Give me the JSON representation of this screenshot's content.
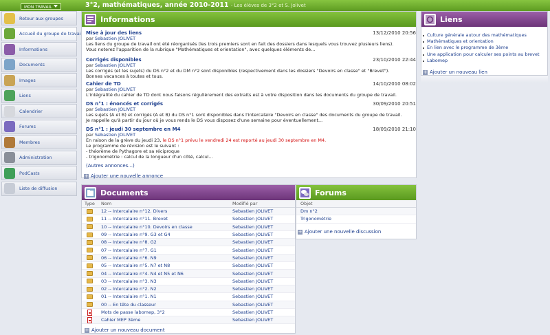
{
  "header": {
    "menu_label": "MON TRAVAIL",
    "title": "3°2, mathématiques, année 2010-2011",
    "subtitle": "- Les élèves de 3°2 et S. Jolivet"
  },
  "sidebar": {
    "items": [
      {
        "label": "Retour aux groupes",
        "icon": "back-arrow-icon",
        "color": "#e3c04a"
      },
      {
        "label": "Accueil du groupe de travail",
        "icon": "home-icon",
        "color": "#6ca83a"
      },
      {
        "label": "Informations",
        "icon": "info-icon",
        "color": "#8b5ca8"
      },
      {
        "label": "Documents",
        "icon": "documents-icon",
        "color": "#7da4c8"
      },
      {
        "label": "Images",
        "icon": "images-icon",
        "color": "#c9a455"
      },
      {
        "label": "Liens",
        "icon": "link-icon",
        "color": "#4ea35a"
      },
      {
        "label": "Calendrier",
        "icon": "calendar-icon",
        "color": "#d6d8dd"
      },
      {
        "label": "Forums",
        "icon": "forums-icon",
        "color": "#7b6bbf"
      },
      {
        "label": "Membres",
        "icon": "members-icon",
        "color": "#b07a3a"
      },
      {
        "label": "Administration",
        "icon": "administration-icon",
        "color": "#8a8f99"
      },
      {
        "label": "PodCasts",
        "icon": "podcast-icon",
        "color": "#3f9f58"
      },
      {
        "label": "Liste de diffusion",
        "icon": "mailing-list-icon",
        "color": "#c7ccd6"
      }
    ]
  },
  "informations": {
    "title": "Informations",
    "items": [
      {
        "title": "Mise à jour des liens",
        "author_prefix": "par",
        "author": "Sebastien JOLIVET",
        "date": "13/12/2010 20:56",
        "body": [
          "Les liens du groupe de travail ont été réorganisés (les trois premiers sont en fait des dossiers dans lesquels vous trouvez plusieurs liens).",
          "Vous noterez l'apparition de la rubrique \"Mathématiques et orientation\", avec quelques éléments de..."
        ]
      },
      {
        "title": "Corrigés disponibles",
        "author_prefix": "par",
        "author": "Sebastien JOLIVET",
        "date": "23/10/2010 22:44",
        "body": [
          "Les corrigés (et les sujets) du DS n°2 et du DM n°2 sont disponibles (respectivement dans les dossiers \"Devoirs en classe\" et \"Brevet\").",
          "Bonnes vacances à toutes et tous."
        ]
      },
      {
        "title": "Cahier de TD",
        "author_prefix": "par",
        "author": "Sebastien JOLIVET",
        "date": "14/10/2010 08:02",
        "body": [
          "L'intégralité du cahier de TD dont nous faisons régulièrement des extraits est à votre disposition dans les documents du groupe de travail."
        ]
      },
      {
        "title": "DS n°1 : énoncés et corrigés",
        "author_prefix": "par",
        "author": "Sebastien JOLIVET",
        "date": "30/09/2010 20:51",
        "body": [
          "Les sujets (A et B) et corrigés (A et B) du DS n°1 sont disponibles dans l'intercalaire \"Devoirs en classe\" des documents du groupe de travail.",
          "Je rappelle qu'à partir du jour où je vous rends le DS vous disposez d'une semaine pour éventuellement..."
        ]
      },
      {
        "title": "DS n°1 : jeudi 30 septembre en M4",
        "author_prefix": "par",
        "author": "Sebastien JOLIVET",
        "date": "18/09/2010 21:10",
        "body_red_prefix": "En raison de la grève du jeudi 23,",
        "body_red": "le DS n°1 prévu le vendredi 24 est reporté au jeudi 30 septembre en M4.",
        "body": [
          "Le programme de révision est le suivant :",
          "- théorème de Pythagore et sa réciproque",
          "- trigonométrie : calcul de la longueur d'un côté, calcul..."
        ]
      }
    ],
    "more_link": "(Autres annonces...)",
    "add_link": "Ajouter une nouvelle annonce"
  },
  "liens": {
    "title": "Liens",
    "items": [
      "Culture générale autour des mathématiques",
      "Mathématiques et orientation",
      "En lien avec le programme de 3ème",
      "Une application pour calculer ses points au brevet",
      "Labomep"
    ],
    "add_link": "Ajouter un nouveau lien"
  },
  "documents": {
    "title": "Documents",
    "columns": {
      "type": "Type",
      "name": "Nom",
      "modified": "Modifié par"
    },
    "rows": [
      {
        "type": "folder",
        "name": "12 -- Intercalaire n°12. Divers",
        "modified": "Sebastien JOLIVET"
      },
      {
        "type": "folder",
        "name": "11 -- Intercalaire n°11. Brevet",
        "modified": "Sebastien JOLIVET"
      },
      {
        "type": "folder",
        "name": "10 -- Intercalaire n°10. Devoirs en classe",
        "modified": "Sebastien JOLIVET"
      },
      {
        "type": "folder",
        "name": "09 -- Intercalaire n°9. G3 et G4",
        "modified": "Sebastien JOLIVET"
      },
      {
        "type": "folder",
        "name": "08 -- Intercalaire n°8. G2",
        "modified": "Sebastien JOLIVET"
      },
      {
        "type": "folder",
        "name": "07 -- Intercalaire n°7. G1",
        "modified": "Sebastien JOLIVET"
      },
      {
        "type": "folder",
        "name": "06 -- Intercalaire n°6. N9",
        "modified": "Sebastien JOLIVET"
      },
      {
        "type": "folder",
        "name": "05 -- Intercalaire n°5. N7 et N8",
        "modified": "Sebastien JOLIVET"
      },
      {
        "type": "folder",
        "name": "04 -- Intercalaire n°4. N4 et N5 et N6",
        "modified": "Sebastien JOLIVET"
      },
      {
        "type": "folder",
        "name": "03 -- Intercalaire n°3. N3",
        "modified": "Sebastien JOLIVET"
      },
      {
        "type": "folder",
        "name": "02 -- Intercalaire n°2. N2",
        "modified": "Sebastien JOLIVET"
      },
      {
        "type": "folder",
        "name": "01 -- Intercalaire n°1. N1",
        "modified": "Sebastien JOLIVET"
      },
      {
        "type": "folder",
        "name": "00 -- En tête du classeur",
        "modified": "Sebastien JOLIVET"
      },
      {
        "type": "pdf",
        "name": "Mots de passe labomep, 3°2",
        "modified": "Sebastien JOLIVET"
      },
      {
        "type": "pdf",
        "name": "Cahier MEP 3ème",
        "modified": "Sebastien JOLIVET"
      }
    ],
    "add_link": "Ajouter un nouveau document"
  },
  "forums": {
    "title": "Forums",
    "column": "Objet",
    "rows": [
      "Dm n°2",
      "Trigonométrie"
    ],
    "add_link": "Ajouter une nouvelle discussion"
  }
}
